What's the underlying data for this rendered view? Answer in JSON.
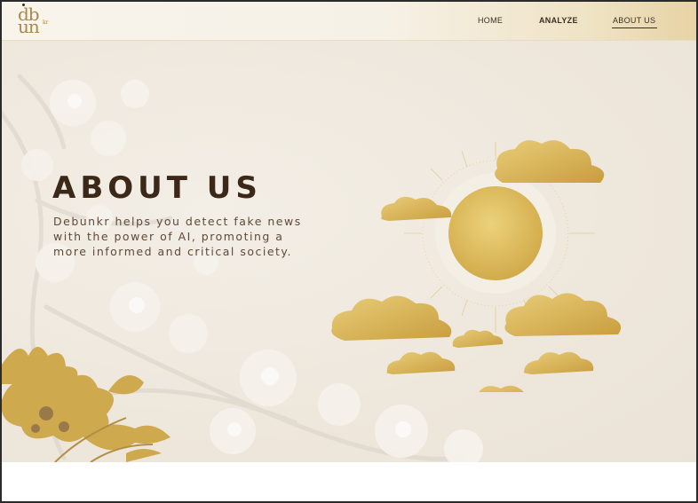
{
  "brand": {
    "logo_line1": "db",
    "logo_line2": "un",
    "logo_suffix": "kr"
  },
  "nav": {
    "home": "HOME",
    "analyze": "ANALYZE",
    "about": "ABOUT US"
  },
  "hero": {
    "title": "ABOUT US",
    "description": "Debunkr helps you detect fake news with the power of AI, promoting a more informed and critical society."
  },
  "colors": {
    "gold": "#d9b656",
    "dark_brown": "#3b2819",
    "text_brown": "#5f4a38",
    "background": "#efe8dd"
  },
  "icons": [
    "sun-cloud-illustration",
    "peony-illustration",
    "cherry-blossom-background"
  ]
}
